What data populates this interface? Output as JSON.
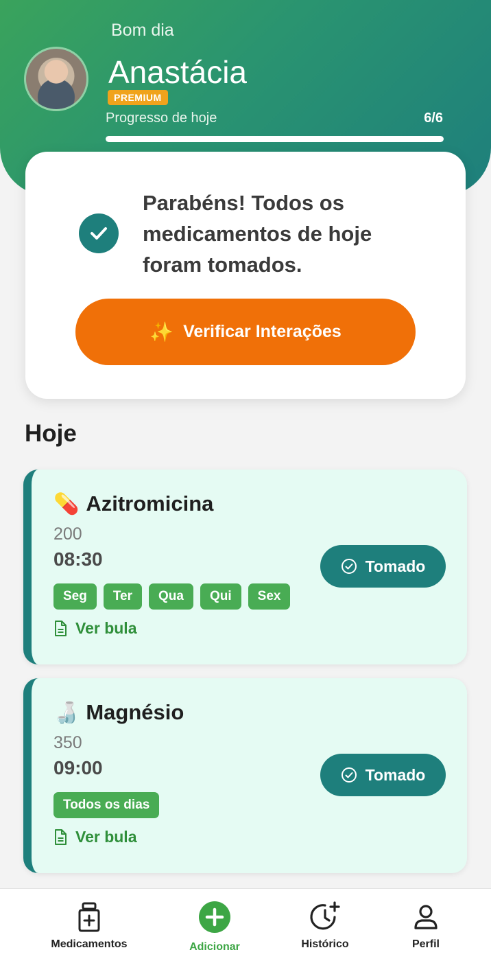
{
  "header": {
    "greeting": "Bom dia",
    "username": "Anastácia",
    "badge": "PREMIUM",
    "progress_label": "Progresso de hoje",
    "progress_count": "6/6",
    "progress_fraction": 1.0
  },
  "congrats": {
    "message": "Parabéns! Todos os medicamentos de hoje foram tomados.",
    "button_icon": "✨",
    "button_label": "Verificar Interações"
  },
  "section_title": "Hoje",
  "medications": [
    {
      "emoji": "💊",
      "name": "Azitromicina",
      "dose": "200",
      "time": "08:30",
      "days": [
        "Seg",
        "Ter",
        "Qua",
        "Qui",
        "Sex"
      ],
      "bula_label": "Ver bula",
      "status_label": "Tomado"
    },
    {
      "emoji": "🍶",
      "name": "Magnésio",
      "dose": "350",
      "time": "09:00",
      "days": [
        "Todos os dias"
      ],
      "bula_label": "Ver bula",
      "status_label": "Tomado"
    }
  ],
  "nav": {
    "medications": "Medicamentos",
    "add": "Adicionar",
    "history": "Histórico",
    "profile": "Perfil"
  },
  "colors": {
    "primary_teal": "#1e7f7c",
    "accent_orange": "#f07008",
    "green": "#49ac54",
    "premium": "#f0a31c"
  }
}
